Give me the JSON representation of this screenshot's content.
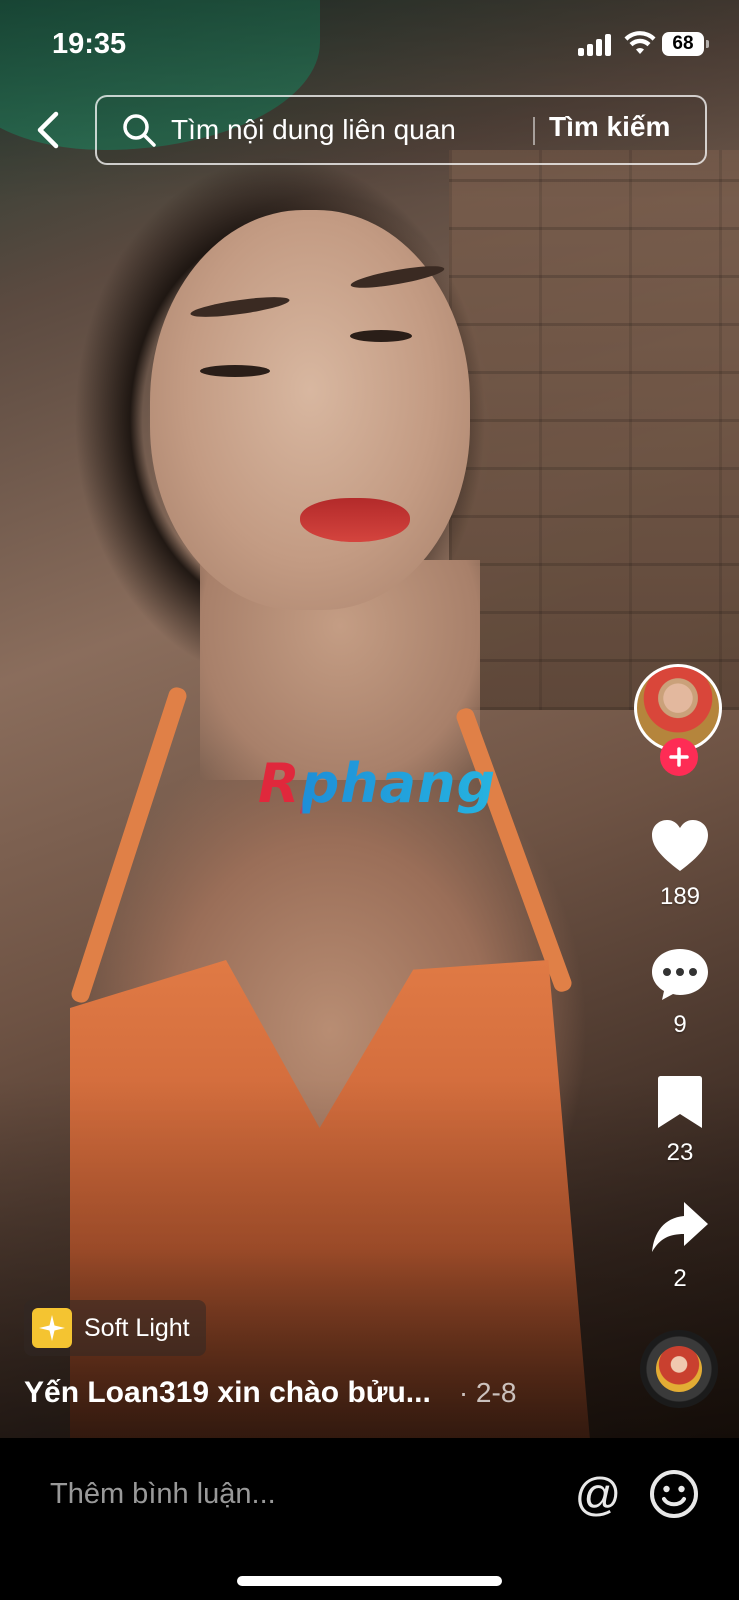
{
  "status_bar": {
    "time": "19:35",
    "battery": "68"
  },
  "search": {
    "placeholder": "Tìm nội dung liên quan",
    "button_label": "Tìm kiếm"
  },
  "watermark": "Rphang",
  "actions": {
    "likes": "189",
    "comments": "9",
    "saves": "23",
    "shares": "2"
  },
  "effect": {
    "label": "Soft Light"
  },
  "caption": {
    "text": "Yến Loan319 xin chào bửu...",
    "date": "· 2-8"
  },
  "comment_bar": {
    "placeholder": "Thêm bình luận..."
  },
  "colors": {
    "accent": "#fe2c55",
    "effect_icon_bg": "#f4c431"
  }
}
